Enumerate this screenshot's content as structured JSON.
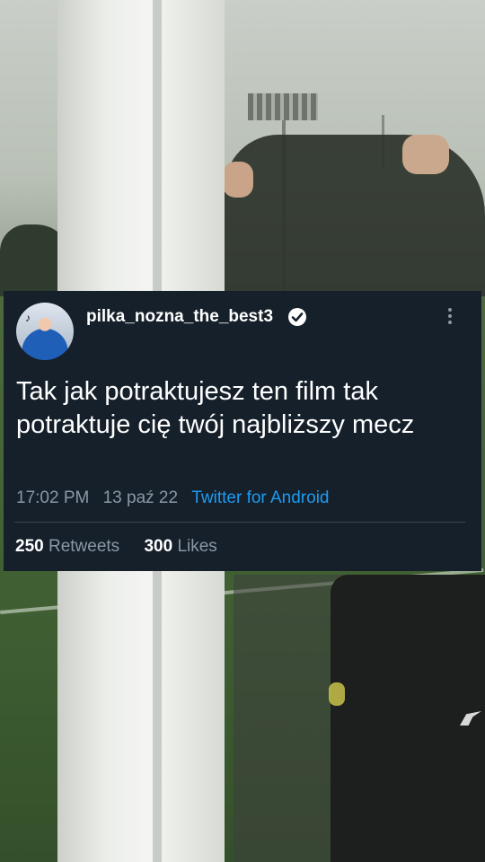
{
  "tweet": {
    "username": "pilka_nozna_the_best3",
    "text": "Tak jak potraktujesz ten film tak potraktuje cię twój najbliższy mecz",
    "time": "17:02 PM",
    "date": "13 paź 22",
    "source": "Twitter for Android",
    "retweets_count": "250",
    "retweets_label": "Retweets",
    "likes_count": "300",
    "likes_label": "Likes"
  },
  "icons": {
    "verified": "verified-badge-icon",
    "more": "more-options-icon",
    "avatar_badge": "tiktok-icon"
  },
  "colors": {
    "card_background": "#15202b",
    "link": "#1d9bf0",
    "secondary_text": "#8b98a5"
  }
}
